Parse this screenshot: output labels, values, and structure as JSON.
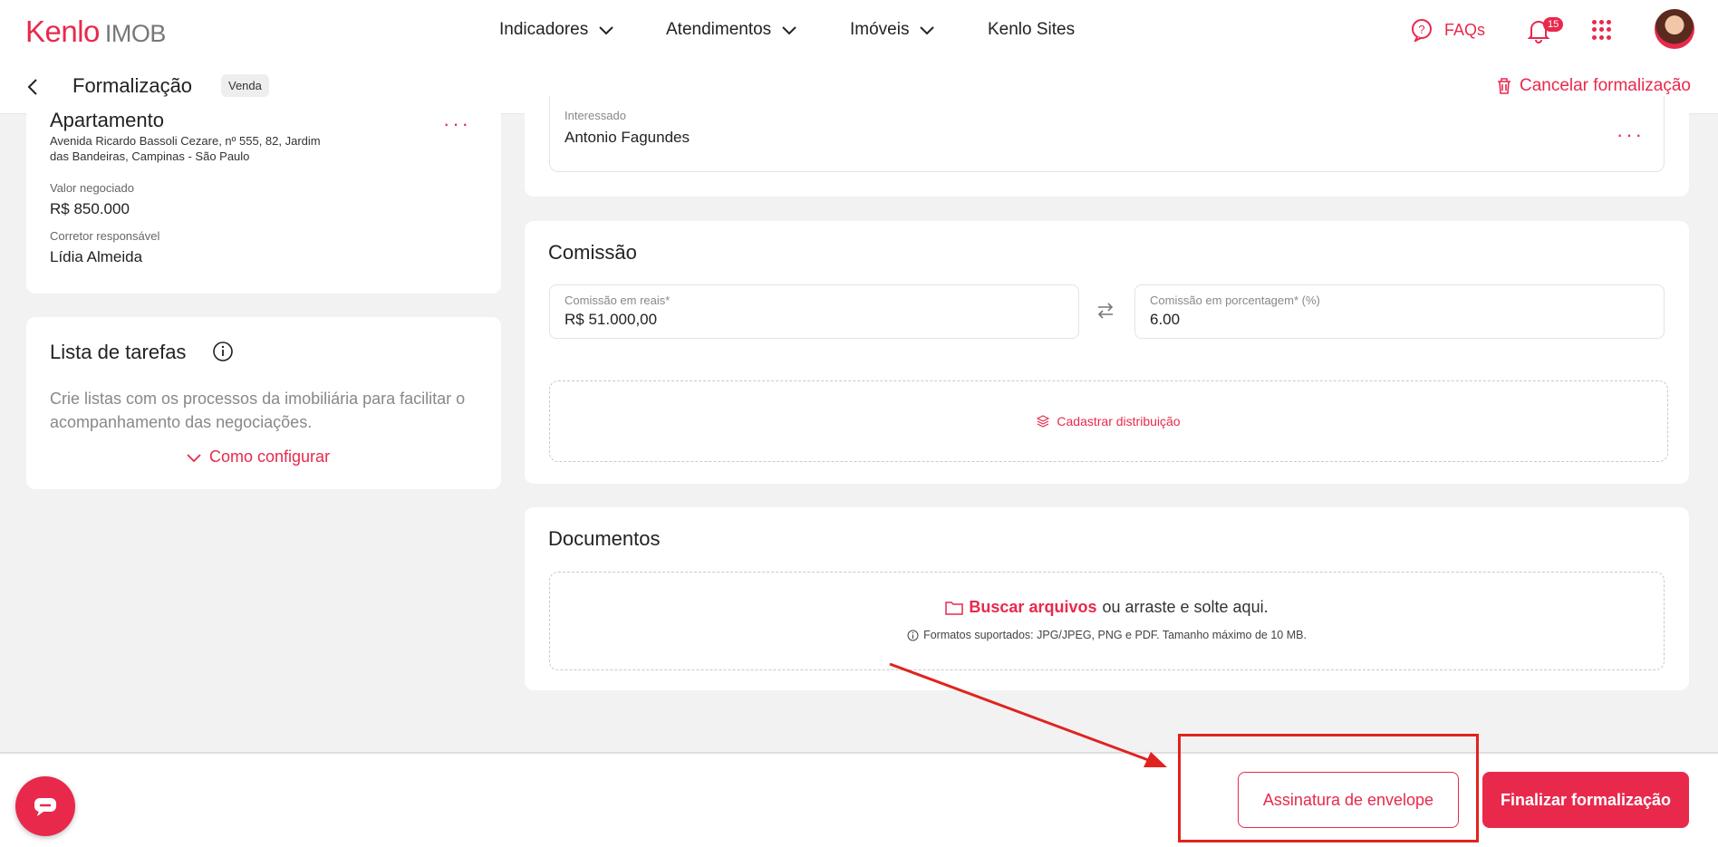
{
  "brand": {
    "logo_main": "Kenlo",
    "logo_sub": "IMOB"
  },
  "nav": {
    "items": [
      {
        "label": "Indicadores"
      },
      {
        "label": "Atendimentos"
      },
      {
        "label": "Imóveis"
      },
      {
        "label": "Kenlo Sites"
      }
    ],
    "faq_label": "FAQs",
    "notification_count": "15"
  },
  "subheader": {
    "title": "Formalização",
    "tag": "Venda",
    "cancel_label": "Cancelar formalização"
  },
  "property": {
    "type": "Apartamento",
    "address_line1": "Avenida Ricardo Bassoli Cezare, nº 555, 82, Jardim",
    "address_line2": "das Bandeiras, Campinas - São Paulo",
    "value_label": "Valor negociado",
    "value": "R$ 850.000",
    "broker_label": "Corretor responsável",
    "broker": "Lídia Almeida"
  },
  "tasks": {
    "title": "Lista de tarefas",
    "description_line1": "Crie listas com os processos da imobiliária para facilitar o",
    "description_line2": "acompanhamento das negociações.",
    "config_label": "Como configurar"
  },
  "interested": {
    "label": "Interessado",
    "value": "Antonio Fagundes"
  },
  "commission": {
    "title": "Comissão",
    "reais_label": "Comissão em reais*",
    "reais_value": "R$ 51.000,00",
    "percent_label": "Comissão em porcentagem* (%)",
    "percent_value": "6.00",
    "distribution_label": "Cadastrar distribuição"
  },
  "documents": {
    "title": "Documentos",
    "browse_label": "Buscar arquivos",
    "drop_text": "ou arraste e solte aqui.",
    "formats_text": "Formatos suportados: JPG/JPEG, PNG e PDF. Tamanho máximo de 10 MB."
  },
  "footer": {
    "envelope_label": "Assinatura de envelope",
    "finish_label": "Finalizar formalização"
  },
  "colors": {
    "accent": "#e8294c",
    "annotation": "#e0231f"
  }
}
